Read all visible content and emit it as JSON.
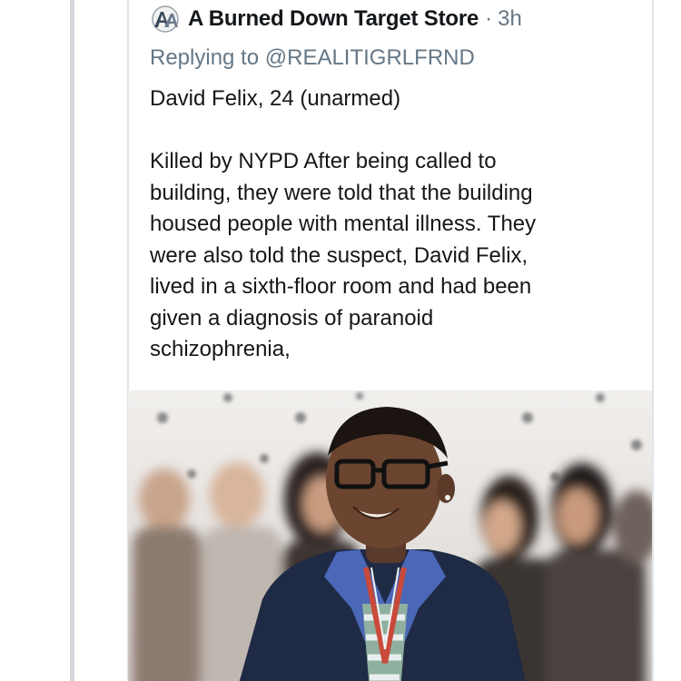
{
  "tweet": {
    "author_name": "A Burned Down Target Store",
    "separator": "·",
    "timestamp": "3h",
    "replying_prefix": "Replying to",
    "replying_handle": "@REALITIGRLFRND",
    "line1": "David Felix, 24 (unarmed)",
    "body": "Killed by NYPD After being called to\nbuilding, they were told that the building\nhoused people with mental illness. They\nwere also told the suspect, David Felix,\nlived in a sixth-floor room and had been\ngiven a diagnosis of paranoid\nschizophrenia,"
  },
  "media": {
    "description_icon": "photo-of-smiling-young-man-with-glasses"
  },
  "colors": {
    "text_primary": "#14171a",
    "text_secondary": "#657786",
    "thread_line": "#d3d6db",
    "card_border": "#e1e4e8"
  }
}
